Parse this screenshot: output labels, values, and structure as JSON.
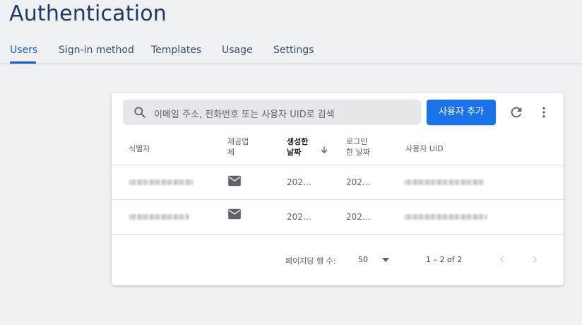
{
  "page": {
    "title": "Authentication"
  },
  "tabs": [
    {
      "label": "Users",
      "active": true
    },
    {
      "label": "Sign-in method",
      "active": false
    },
    {
      "label": "Templates",
      "active": false
    },
    {
      "label": "Usage",
      "active": false
    },
    {
      "label": "Settings",
      "active": false
    }
  ],
  "toolbar": {
    "search_placeholder": "이메일 주소, 전화번호 또는 사용자 UID로 검색",
    "add_user_label": "사용자 추가",
    "icons": [
      "search-icon",
      "refresh-icon",
      "more-vert-icon"
    ]
  },
  "table": {
    "columns": [
      {
        "label": "식별자"
      },
      {
        "label": "제공업\n체"
      },
      {
        "label": "생성한\n날짜",
        "sorted": "desc"
      },
      {
        "label": "로그인\n한 날짜"
      },
      {
        "label": "사용자 UID"
      }
    ],
    "rows": [
      {
        "identifier": "(blurred)",
        "provider_icon": "email-icon",
        "created": "202…",
        "signed_in": "202…",
        "uid": "(blurred)"
      },
      {
        "identifier": "(blurred)",
        "provider_icon": "email-icon",
        "created": "202…",
        "signed_in": "202…",
        "uid": "(blurred)"
      }
    ]
  },
  "pagination": {
    "rows_per_page_label": "페이지당 행 수:",
    "rows_per_page_value": "50",
    "range_text": "1 – 2 of 2"
  },
  "colors": {
    "primary": "#1a73e8",
    "title": "#1f3a5f",
    "background": "#eef0f4"
  }
}
